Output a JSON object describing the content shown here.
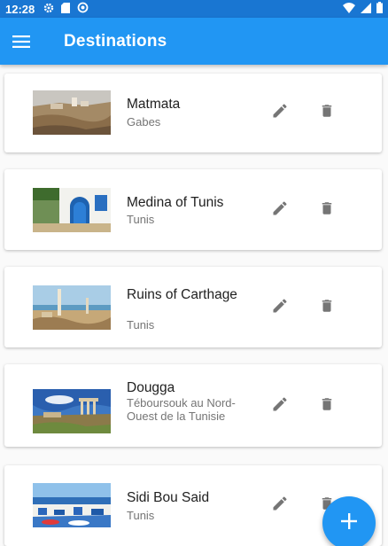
{
  "status": {
    "time": "12:28",
    "icons": [
      "gear-icon",
      "sd-card-icon",
      "sync-icon",
      "wifi-icon",
      "signal-icon",
      "battery-icon"
    ]
  },
  "appbar": {
    "title": "Destinations",
    "menu_icon": "menu-icon"
  },
  "destinations": [
    {
      "name": "Matmata",
      "region": "Gabes"
    },
    {
      "name": "Medina of Tunis",
      "region": "Tunis"
    },
    {
      "name": "Ruins of Carthage",
      "region": "Tunis"
    },
    {
      "name": "Dougga",
      "region": "Téboursouk au Nord-Ouest de la Tunisie"
    },
    {
      "name": "Sidi Bou Said",
      "region": "Tunis"
    }
  ],
  "actions": {
    "edit_icon": "pencil-icon",
    "delete_icon": "trash-icon",
    "fab_icon": "plus-icon"
  },
  "colors": {
    "primary": "#2196f3",
    "status_bar": "#1976d2",
    "icon_grey": "#757575"
  }
}
